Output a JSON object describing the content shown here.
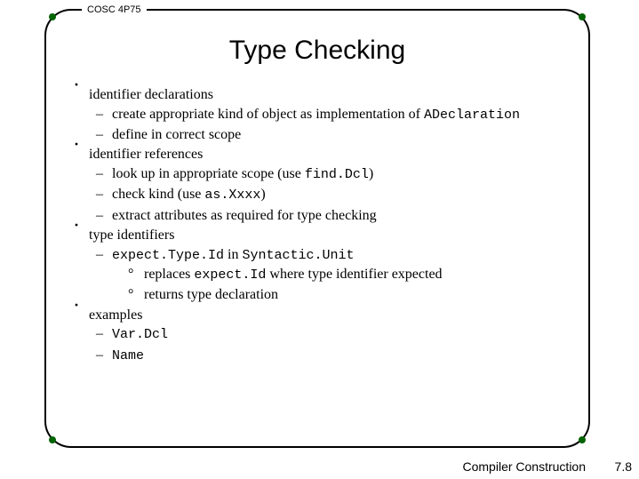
{
  "course": "COSC 4P75",
  "title": "Type Checking",
  "bullets": {
    "b1": "identifier declarations",
    "b1a_pre": "create appropriate kind of object as implementation of ",
    "b1a_code": "ADeclaration",
    "b1b": "define in correct scope",
    "b2": "identifier references",
    "b2a_pre": "look up in appropriate scope (use ",
    "b2a_code": "find.Dcl",
    "b2a_post": ")",
    "b2b_pre": "check kind (use ",
    "b2b_code": "as.Xxxx",
    "b2b_post": ")",
    "b2c": "extract attributes as required for type checking",
    "b3": "type identifiers",
    "b3a_code": "expect.Type.Id",
    "b3a_mid": " in ",
    "b3a_code2": "Syntactic.Unit",
    "b3a1_pre": "replaces ",
    "b3a1_code": "expect.Id",
    "b3a1_post": " where type identifier expected",
    "b3a2": "returns type declaration",
    "b4": "examples",
    "b4a": "Var.Dcl",
    "b4b": "Name"
  },
  "footer": {
    "left": "Compiler Construction",
    "right": "7.8"
  }
}
